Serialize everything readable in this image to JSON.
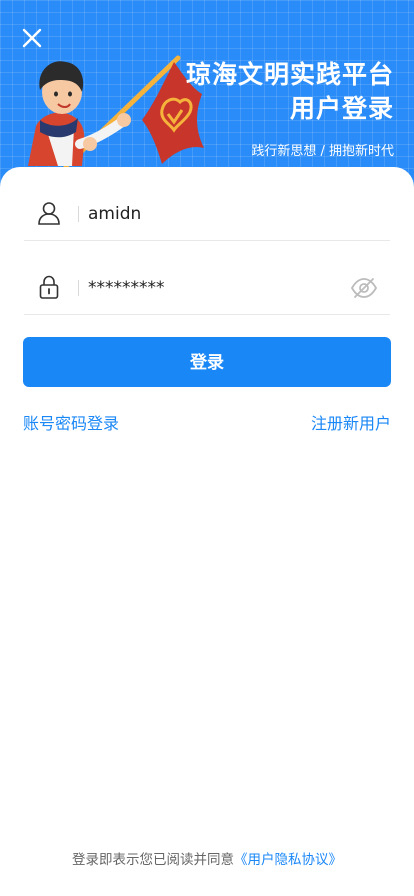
{
  "header": {
    "title_line1": "琼海文明实践平台",
    "title_line2": "用户登录",
    "slogan": "践行新思想 / 拥抱新时代"
  },
  "form": {
    "username_value": "amidn",
    "password_mask": "*********"
  },
  "actions": {
    "login_label": "登录",
    "account_login_label": "账号密码登录",
    "register_label": "注册新用户"
  },
  "footer": {
    "agreement_prefix": "登录即表示您已阅读并同意",
    "policy_label": "《用户隐私协议》"
  },
  "colors": {
    "primary": "#1a87f7",
    "header_bg": "#2a8cf8",
    "flag_red": "#c8352a",
    "flag_gold": "#f5b33c"
  },
  "icons": [
    "close-icon",
    "user-icon",
    "lock-icon",
    "eye-hidden-icon"
  ]
}
